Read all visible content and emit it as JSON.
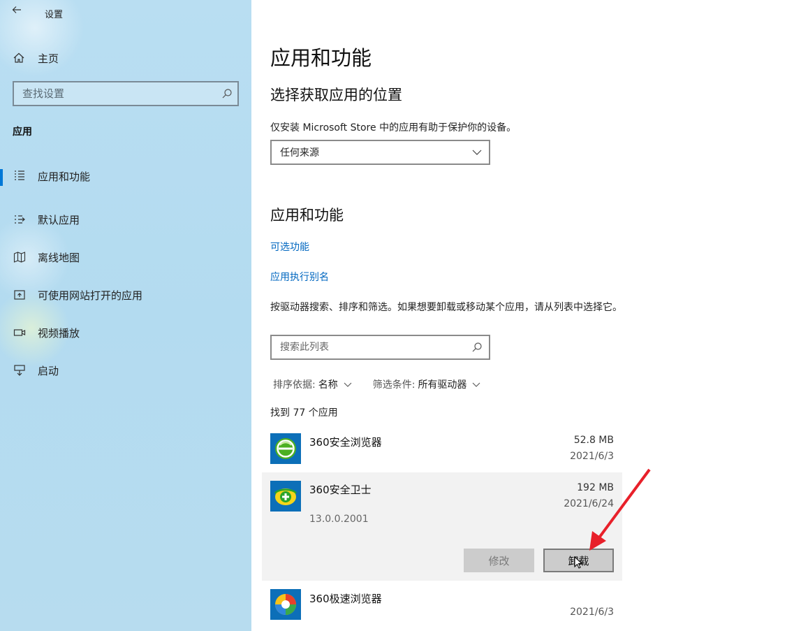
{
  "window": {
    "title": "设置",
    "back_icon": "back-arrow-icon"
  },
  "sidebar": {
    "home_label": "主页",
    "search_placeholder": "查找设置",
    "section_title": "应用",
    "items": [
      {
        "label": "应用和功能",
        "icon": "apps-list-icon",
        "active": true
      },
      {
        "label": "默认应用",
        "icon": "default-apps-icon",
        "active": false
      },
      {
        "label": "离线地图",
        "icon": "map-icon",
        "active": false
      },
      {
        "label": "可使用网站打开的应用",
        "icon": "open-website-icon",
        "active": false
      },
      {
        "label": "视频播放",
        "icon": "video-icon",
        "active": false
      },
      {
        "label": "启动",
        "icon": "startup-icon",
        "active": false
      }
    ]
  },
  "main": {
    "title": "应用和功能",
    "install_section": {
      "heading": "选择获取应用的位置",
      "description": "仅安装 Microsoft Store 中的应用有助于保护你的设备。",
      "dropdown_value": "任何来源"
    },
    "apps_section": {
      "heading": "应用和功能",
      "optional_features_link": "可选功能",
      "alias_link": "应用执行别名",
      "description": "按驱动器搜索、排序和筛选。如果想要卸载或移动某个应用，请从列表中选择它。",
      "search_placeholder": "搜索此列表",
      "sort_label": "排序依据:",
      "sort_value": "名称",
      "filter_label": "筛选条件:",
      "filter_value": "所有驱动器",
      "found_text": "找到 77 个应用"
    },
    "apps": [
      {
        "name": "360安全浏览器",
        "size": "52.8 MB",
        "date": "2021/6/3",
        "icon": "360-browser-icon"
      },
      {
        "name": "360安全卫士",
        "size": "192 MB",
        "date": "2021/6/24",
        "version": "13.0.0.2001",
        "icon": "360-security-icon",
        "expanded": true,
        "modify_label": "修改",
        "uninstall_label": "卸载"
      },
      {
        "name": "360极速浏览器",
        "size": "",
        "date": "2021/6/3",
        "icon": "360-speed-browser-icon"
      }
    ]
  },
  "colors": {
    "accent": "#0078d7",
    "link": "#0067c0",
    "annotation_arrow": "#e8202a",
    "sidebar_bg": "#b7dcf0"
  }
}
